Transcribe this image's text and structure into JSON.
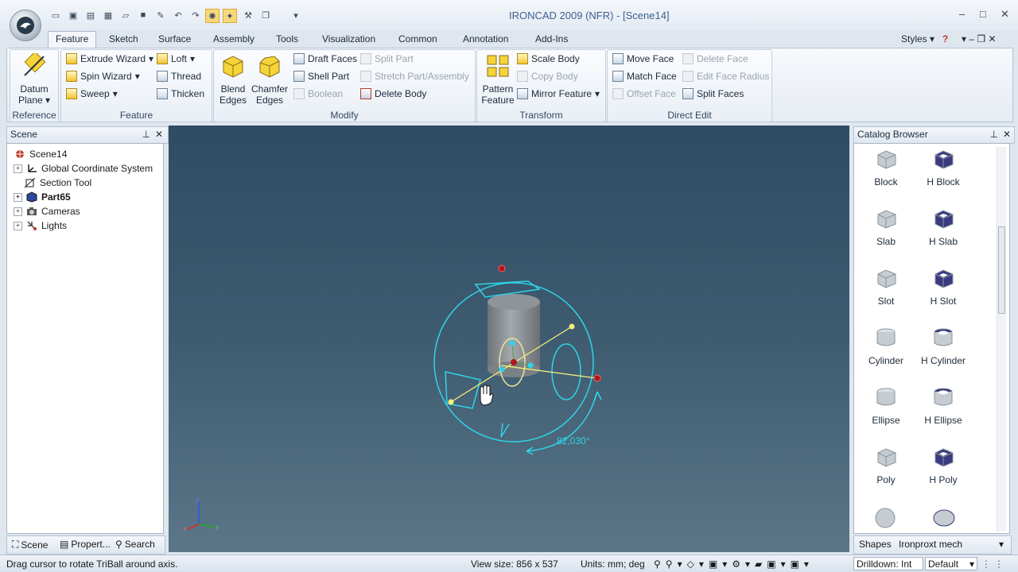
{
  "window": {
    "title": "IRONCAD 2009 (NFR) - [Scene14]",
    "minimize": "–",
    "restore": "□",
    "close": "✕"
  },
  "quick_access": [
    "new-icon",
    "save-icon",
    "export-icon",
    "print-icon",
    "open-icon",
    "save-all-icon",
    "edit-icon",
    "undo-icon",
    "redo-icon",
    "triball-icon",
    "smartsnap-icon",
    "tools-icon",
    "window-icon",
    "customize-icon"
  ],
  "tabs": [
    "Feature",
    "Sketch",
    "Surface",
    "Assembly",
    "Tools",
    "Visualization",
    "Common",
    "Annotation",
    "Add-Ins"
  ],
  "ribbon_right": {
    "styles": "Styles",
    "help": "?"
  },
  "groups": {
    "reference": {
      "label": "Reference",
      "datum_plane": "Datum Plane",
      "datum_line1": "Datum",
      "datum_line2": "Plane"
    },
    "feature": {
      "label": "Feature",
      "extrude": "Extrude Wizard",
      "spin": "Spin Wizard",
      "sweep": "Sweep",
      "loft": "Loft",
      "thread": "Thread",
      "thicken": "Thicken"
    },
    "modify": {
      "label": "Modify",
      "blend_1": "Blend",
      "blend_2": "Edges",
      "chamfer_1": "Chamfer",
      "chamfer_2": "Edges",
      "draft": "Draft Faces",
      "shell": "Shell Part",
      "boolean": "Boolean",
      "split_part": "Split Part",
      "stretch": "Stretch Part/Assembly",
      "delete_body": "Delete Body"
    },
    "transform": {
      "label": "Transform",
      "pattern_1": "Pattern",
      "pattern_2": "Feature",
      "scale": "Scale Body",
      "copy": "Copy Body",
      "mirror": "Mirror Feature"
    },
    "direct_edit": {
      "label": "Direct Edit",
      "move_face": "Move Face",
      "match_face": "Match Face",
      "offset_face": "Offset Face",
      "delete_face": "Delete Face",
      "edit_radius": "Edit Face Radius",
      "split_faces": "Split Faces"
    }
  },
  "scene_panel": {
    "title": "Scene",
    "items": [
      {
        "label": "Scene14",
        "bold": false
      },
      {
        "label": "Global Coordinate System",
        "bold": false
      },
      {
        "label": "Section Tool",
        "bold": false
      },
      {
        "label": "Part65",
        "bold": true
      },
      {
        "label": "Cameras",
        "bold": false
      },
      {
        "label": "Lights",
        "bold": false
      }
    ],
    "bottom_tabs": [
      "Scene",
      "Propert...",
      "Search"
    ]
  },
  "viewport": {
    "angle_readout": "82,030°"
  },
  "catalog": {
    "title": "Catalog Browser",
    "items": [
      {
        "label": "Block"
      },
      {
        "label": "H Block"
      },
      {
        "label": "Slab"
      },
      {
        "label": "H Slab"
      },
      {
        "label": "Slot"
      },
      {
        "label": "H Slot"
      },
      {
        "label": "Cylinder"
      },
      {
        "label": "H Cylinder"
      },
      {
        "label": "Ellipse"
      },
      {
        "label": "H Ellipse"
      },
      {
        "label": "Poly"
      },
      {
        "label": "H Poly"
      }
    ],
    "bottom_tabs": [
      "Shapes",
      "Ironproxt mech"
    ]
  },
  "status": {
    "message": "Drag cursor to rotate TriBall around axis.",
    "view_size": "View size: 856 x 537",
    "units": "Units: mm; deg",
    "drilldown": "Drilldown: Int",
    "default": "Default"
  },
  "colors": {
    "viewport_top": "#2f4c63",
    "viewport_bottom": "#5b7688",
    "triball": "#2fd4e8",
    "axis_line": "#f2f07a",
    "accent_title": "#3b5f8f"
  }
}
